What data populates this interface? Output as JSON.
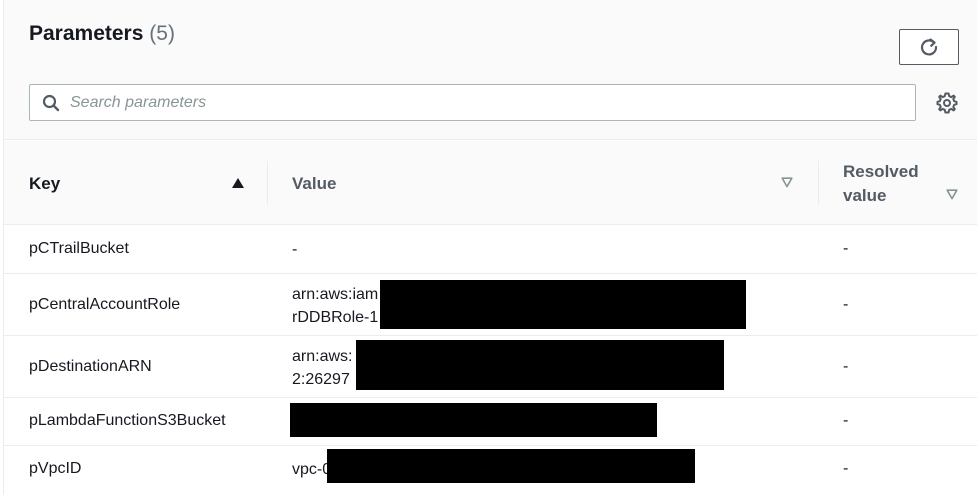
{
  "header": {
    "title": "Parameters",
    "count": "(5)"
  },
  "search": {
    "placeholder": "Search parameters",
    "value": ""
  },
  "icons": {
    "refresh": "refresh-icon",
    "search": "search-icon",
    "settings": "gear-icon",
    "sort_asc": "caret-up-icon",
    "sort_none": "caret-down-outline-icon"
  },
  "table": {
    "columns": [
      {
        "label": "Key"
      },
      {
        "label": "Value"
      },
      {
        "label": "Resolved value"
      }
    ],
    "rows": [
      {
        "key": "pCTrailBucket",
        "value_lines": [
          "-"
        ],
        "resolved": "-"
      },
      {
        "key": "pCentralAccountRole",
        "value_lines": [
          "arn:aws:iam",
          "rDDBRole-1"
        ],
        "resolved": "-"
      },
      {
        "key": "pDestinationARN",
        "value_lines": [
          "arn:aws:",
          "2:26297"
        ],
        "resolved": "-"
      },
      {
        "key": "pLambdaFunctionS3Bucket",
        "value_lines": [
          ""
        ],
        "resolved": "-"
      },
      {
        "key": "pVpcID",
        "value_lines": [
          "vpc-0"
        ],
        "resolved": "-"
      }
    ]
  },
  "colors": {
    "text": "#16191f",
    "muted": "#687078",
    "border": "#eaeded",
    "header_bg": "#fafafa",
    "redaction": "#000000"
  }
}
